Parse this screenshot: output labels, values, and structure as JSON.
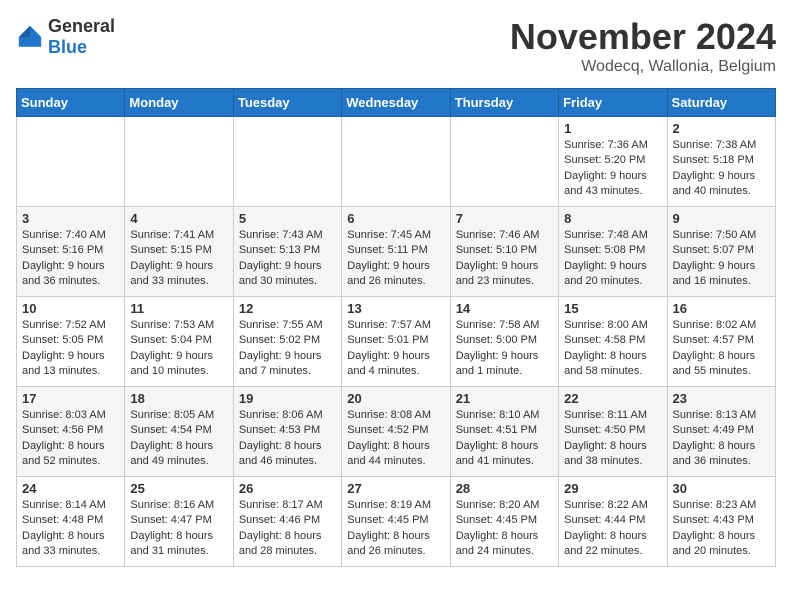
{
  "logo": {
    "general": "General",
    "blue": "Blue"
  },
  "title": "November 2024",
  "subtitle": "Wodecq, Wallonia, Belgium",
  "days_of_week": [
    "Sunday",
    "Monday",
    "Tuesday",
    "Wednesday",
    "Thursday",
    "Friday",
    "Saturday"
  ],
  "weeks": [
    [
      {
        "day": "",
        "info": ""
      },
      {
        "day": "",
        "info": ""
      },
      {
        "day": "",
        "info": ""
      },
      {
        "day": "",
        "info": ""
      },
      {
        "day": "",
        "info": ""
      },
      {
        "day": "1",
        "info": "Sunrise: 7:36 AM\nSunset: 5:20 PM\nDaylight: 9 hours and 43 minutes."
      },
      {
        "day": "2",
        "info": "Sunrise: 7:38 AM\nSunset: 5:18 PM\nDaylight: 9 hours and 40 minutes."
      }
    ],
    [
      {
        "day": "3",
        "info": "Sunrise: 7:40 AM\nSunset: 5:16 PM\nDaylight: 9 hours and 36 minutes."
      },
      {
        "day": "4",
        "info": "Sunrise: 7:41 AM\nSunset: 5:15 PM\nDaylight: 9 hours and 33 minutes."
      },
      {
        "day": "5",
        "info": "Sunrise: 7:43 AM\nSunset: 5:13 PM\nDaylight: 9 hours and 30 minutes."
      },
      {
        "day": "6",
        "info": "Sunrise: 7:45 AM\nSunset: 5:11 PM\nDaylight: 9 hours and 26 minutes."
      },
      {
        "day": "7",
        "info": "Sunrise: 7:46 AM\nSunset: 5:10 PM\nDaylight: 9 hours and 23 minutes."
      },
      {
        "day": "8",
        "info": "Sunrise: 7:48 AM\nSunset: 5:08 PM\nDaylight: 9 hours and 20 minutes."
      },
      {
        "day": "9",
        "info": "Sunrise: 7:50 AM\nSunset: 5:07 PM\nDaylight: 9 hours and 16 minutes."
      }
    ],
    [
      {
        "day": "10",
        "info": "Sunrise: 7:52 AM\nSunset: 5:05 PM\nDaylight: 9 hours and 13 minutes."
      },
      {
        "day": "11",
        "info": "Sunrise: 7:53 AM\nSunset: 5:04 PM\nDaylight: 9 hours and 10 minutes."
      },
      {
        "day": "12",
        "info": "Sunrise: 7:55 AM\nSunset: 5:02 PM\nDaylight: 9 hours and 7 minutes."
      },
      {
        "day": "13",
        "info": "Sunrise: 7:57 AM\nSunset: 5:01 PM\nDaylight: 9 hours and 4 minutes."
      },
      {
        "day": "14",
        "info": "Sunrise: 7:58 AM\nSunset: 5:00 PM\nDaylight: 9 hours and 1 minute."
      },
      {
        "day": "15",
        "info": "Sunrise: 8:00 AM\nSunset: 4:58 PM\nDaylight: 8 hours and 58 minutes."
      },
      {
        "day": "16",
        "info": "Sunrise: 8:02 AM\nSunset: 4:57 PM\nDaylight: 8 hours and 55 minutes."
      }
    ],
    [
      {
        "day": "17",
        "info": "Sunrise: 8:03 AM\nSunset: 4:56 PM\nDaylight: 8 hours and 52 minutes."
      },
      {
        "day": "18",
        "info": "Sunrise: 8:05 AM\nSunset: 4:54 PM\nDaylight: 8 hours and 49 minutes."
      },
      {
        "day": "19",
        "info": "Sunrise: 8:06 AM\nSunset: 4:53 PM\nDaylight: 8 hours and 46 minutes."
      },
      {
        "day": "20",
        "info": "Sunrise: 8:08 AM\nSunset: 4:52 PM\nDaylight: 8 hours and 44 minutes."
      },
      {
        "day": "21",
        "info": "Sunrise: 8:10 AM\nSunset: 4:51 PM\nDaylight: 8 hours and 41 minutes."
      },
      {
        "day": "22",
        "info": "Sunrise: 8:11 AM\nSunset: 4:50 PM\nDaylight: 8 hours and 38 minutes."
      },
      {
        "day": "23",
        "info": "Sunrise: 8:13 AM\nSunset: 4:49 PM\nDaylight: 8 hours and 36 minutes."
      }
    ],
    [
      {
        "day": "24",
        "info": "Sunrise: 8:14 AM\nSunset: 4:48 PM\nDaylight: 8 hours and 33 minutes."
      },
      {
        "day": "25",
        "info": "Sunrise: 8:16 AM\nSunset: 4:47 PM\nDaylight: 8 hours and 31 minutes."
      },
      {
        "day": "26",
        "info": "Sunrise: 8:17 AM\nSunset: 4:46 PM\nDaylight: 8 hours and 28 minutes."
      },
      {
        "day": "27",
        "info": "Sunrise: 8:19 AM\nSunset: 4:45 PM\nDaylight: 8 hours and 26 minutes."
      },
      {
        "day": "28",
        "info": "Sunrise: 8:20 AM\nSunset: 4:45 PM\nDaylight: 8 hours and 24 minutes."
      },
      {
        "day": "29",
        "info": "Sunrise: 8:22 AM\nSunset: 4:44 PM\nDaylight: 8 hours and 22 minutes."
      },
      {
        "day": "30",
        "info": "Sunrise: 8:23 AM\nSunset: 4:43 PM\nDaylight: 8 hours and 20 minutes."
      }
    ]
  ]
}
